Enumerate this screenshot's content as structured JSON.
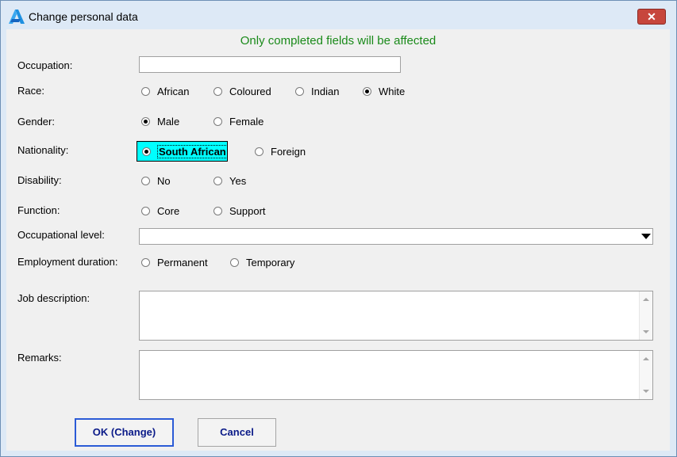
{
  "window": {
    "title": "Change personal data",
    "close_glyph": "✕"
  },
  "notice": "Only completed fields will be affected",
  "occupation": {
    "label": "Occupation:",
    "value": ""
  },
  "race": {
    "label": "Race:",
    "options": [
      "African",
      "Coloured",
      "Indian",
      "White"
    ],
    "selected": "White"
  },
  "gender": {
    "label": "Gender:",
    "options": [
      "Male",
      "Female"
    ],
    "selected": "Male"
  },
  "nationality": {
    "label": "Nationality:",
    "options": [
      "South African",
      "Foreign"
    ],
    "selected": "South African"
  },
  "disability": {
    "label": "Disability:",
    "options": [
      "No",
      "Yes"
    ],
    "selected": ""
  },
  "function": {
    "label": "Function:",
    "options": [
      "Core",
      "Support"
    ],
    "selected": ""
  },
  "occupational_level": {
    "label": "Occupational level:",
    "value": ""
  },
  "employment_duration": {
    "label": "Employment duration:",
    "options": [
      "Permanent",
      "Temporary"
    ],
    "selected": ""
  },
  "job_description": {
    "label": "Job description:",
    "value": ""
  },
  "remarks": {
    "label": "Remarks:",
    "value": ""
  },
  "buttons": {
    "ok": "OK (Change)",
    "cancel": "Cancel"
  },
  "colors": {
    "highlight": "#00ffff",
    "notice": "#1a8a1a",
    "button_text": "#0a1a88"
  },
  "icons": {
    "app": "app-logo-icon",
    "close": "close-icon"
  }
}
